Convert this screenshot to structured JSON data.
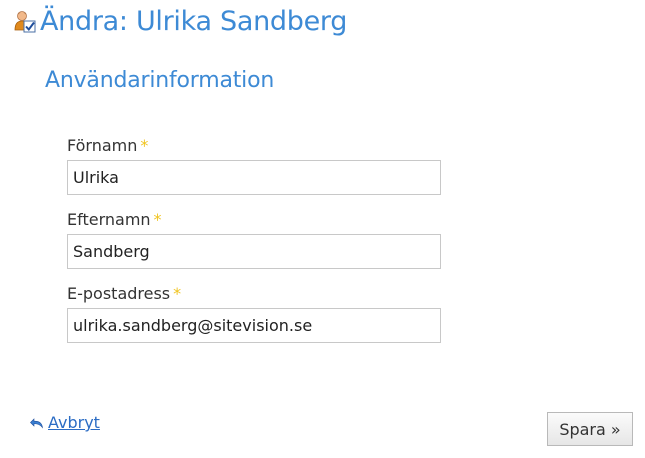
{
  "header": {
    "title": "Ändra: Ulrika Sandberg",
    "icon": "user-edit-icon"
  },
  "section": {
    "title": "Användarinformation"
  },
  "form": {
    "required_marker": "*",
    "fields": [
      {
        "label": "Förnamn",
        "value": "Ulrika"
      },
      {
        "label": "Efternamn",
        "value": "Sandberg"
      },
      {
        "label": "E-postadress",
        "value": "ulrika.sandberg@sitevision.se"
      }
    ]
  },
  "actions": {
    "cancel_label": "Avbryt",
    "cancel_icon": "undo-icon",
    "save_label": "Spara »"
  },
  "colors": {
    "accent": "#3d8ad5",
    "link": "#2b6cc4",
    "required": "#f0c420"
  }
}
